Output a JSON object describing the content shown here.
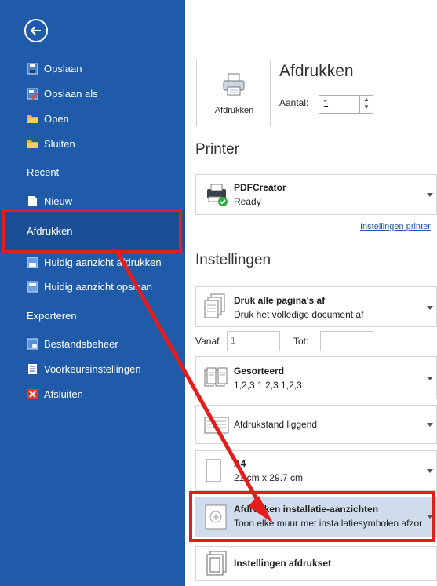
{
  "sidebar": {
    "items_top": [
      "Opslaan",
      "Opslaan als",
      "Open",
      "Sluiten"
    ],
    "recent_heading": "Recent",
    "new_label": "Nieuw",
    "print_label": "Afdrukken",
    "print_subitems": [
      "Huidig aanzicht afdrukken",
      "Huidig aanzicht opslaan"
    ],
    "export_heading": "Exporteren",
    "bottom_items": [
      "Bestandsbeheer",
      "Voorkeursinstellingen",
      "Afsluiten"
    ]
  },
  "main": {
    "title": "Afdrukken",
    "print_button_label": "Afdrukken",
    "copies_label": "Aantal:",
    "copies_value": "1",
    "printer_heading": "Printer",
    "printer_name": "PDFCreator",
    "printer_status": "Ready",
    "printer_settings_link": "Instellingen printer",
    "settings_heading": "Instellingen",
    "pages_title": "Druk alle pagina's af",
    "pages_sub": "Druk het volledige document af",
    "from_label": "Vanaf",
    "from_value": "1",
    "to_label": "Tot:",
    "collate_title": "Gesorteerd",
    "collate_sub": "1,2,3 1,2,3 1,2,3",
    "orientation_label": "Afdrukstand liggend",
    "paper_title": "A4",
    "paper_sub": "21 cm x 29.7 cm",
    "install_title": "Afdrukken installatie-aanzichten",
    "install_sub": "Toon elke muur met installatiesymbolen afzonderlijk",
    "printset_label": "Instellingen afdrukset"
  },
  "colors": {
    "sidebar": "#1f5ba8",
    "highlight": "#e51c1c",
    "selected_card": "#cfdcec"
  }
}
